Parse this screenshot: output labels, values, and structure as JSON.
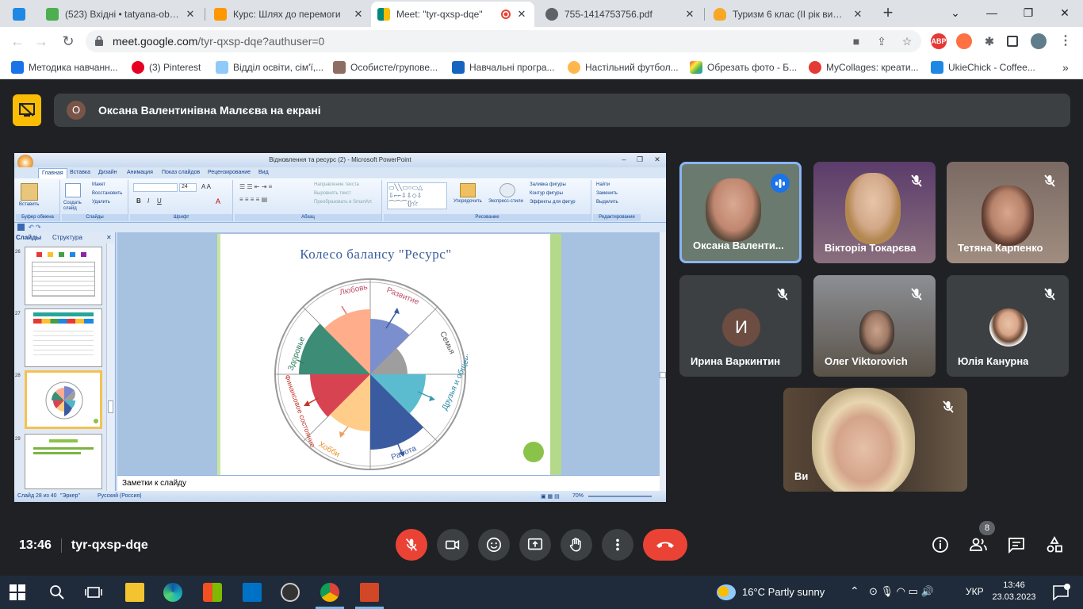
{
  "browser": {
    "tabs": [
      {
        "title": "",
        "color": "#1e88e5"
      },
      {
        "title": "(523) Вхідні • tatyana-obyh",
        "color": "#4caf50"
      },
      {
        "title": "Курс: Шлях до перемоги",
        "color": "#ff9800"
      },
      {
        "title": "Meet: \"tyr-qxsp-dqe\"",
        "color": "#00897b"
      },
      {
        "title": "755-1414753756.pdf",
        "color": "#5f6368"
      },
      {
        "title": "Туризм 6 клас (ІІ рік вивче",
        "color": "#f9a825"
      }
    ],
    "url_host": "meet.google.com",
    "url_path": "/tyr-qxsp-dqe?authuser=0",
    "bookmarks": [
      {
        "label": "Методика навчанн...",
        "color": "#1a73e8"
      },
      {
        "label": "(3) Pinterest",
        "color": "#e60023"
      },
      {
        "label": "Відділ освіти, сім'ї,...",
        "color": "#90caf9"
      },
      {
        "label": "Особисте/групове...",
        "color": "#8d6e63"
      },
      {
        "label": "Навчальні програ...",
        "color": "#1565c0"
      },
      {
        "label": "Настільний футбол...",
        "color": "#ffb74d"
      },
      {
        "label": "Обрезать фото - Б...",
        "color": "#ab47bc"
      },
      {
        "label": "MyCollages: креати...",
        "color": "#e53935"
      },
      {
        "label": "UkieChick - Coffee...",
        "color": "#1e88e5"
      }
    ],
    "ext_abp": "ABP"
  },
  "meet": {
    "presenting_initial": "О",
    "presenting_text": "Оксана Валентинівна Малєєва на екрані",
    "meeting_time": "13:46",
    "meeting_code": "tyr-qxsp-dqe",
    "participant_count": "8",
    "participants": [
      {
        "name": "Оксана Валенти...",
        "initial": ""
      },
      {
        "name": "Вікторія Токарєва",
        "initial": ""
      },
      {
        "name": "Тетяна Карпенко",
        "initial": ""
      },
      {
        "name": "Ирина Варкинтин",
        "initial": "И"
      },
      {
        "name": "Олег Viktorovich",
        "initial": ""
      },
      {
        "name": "Юлія Канурна",
        "initial": ""
      },
      {
        "name": "Ви",
        "initial": ""
      }
    ]
  },
  "ppt": {
    "title": "Відновлення та ресурс (2) - Microsoft PowerPoint",
    "menu": [
      "Главная",
      "Вставка",
      "Дизайн",
      "Анимация",
      "Показ слайдов",
      "Рецензирование",
      "Вид"
    ],
    "ribbon_groups": [
      "Буфер обмена",
      "Слайды",
      "Шрифт",
      "Абзац",
      "Рисование",
      "Редактирование"
    ],
    "ribbon_buttons": [
      "Вставить",
      "Создать слайд",
      "Макет",
      "Восстановить",
      "Удалить",
      "Направление текста",
      "Выровнять текст",
      "Преобразовать в SmartArt",
      "Упорядочить",
      "Экспресс-стили",
      "Заливка фигуры",
      "Контур фигуры",
      "Эффекты для фигур",
      "Найти",
      "Заменить",
      "Выделить"
    ],
    "font_size": "24",
    "panel_tabs": [
      "Слайды",
      "Структура"
    ],
    "thumb_numbers": [
      "26",
      "27",
      "28",
      "29"
    ],
    "notes_placeholder": "Заметки к слайду",
    "status_slide": "Слайд 28 из 40",
    "status_theme": "\"Эркер\"",
    "status_lang": "Русский (Россия)",
    "status_zoom": "70%",
    "slide_title": "Колесо балансу \"Ресурс\"",
    "wheel_labels": [
      "Любовь",
      "Развитие",
      "Семья",
      "Друзья и общение",
      "Работа",
      "Хобби",
      "Финансовое состояние",
      "Здоровье"
    ]
  },
  "taskbar": {
    "weather": "16°C  Partly sunny",
    "lang": "УКР",
    "time": "13:46",
    "date": "23.03.2023"
  }
}
